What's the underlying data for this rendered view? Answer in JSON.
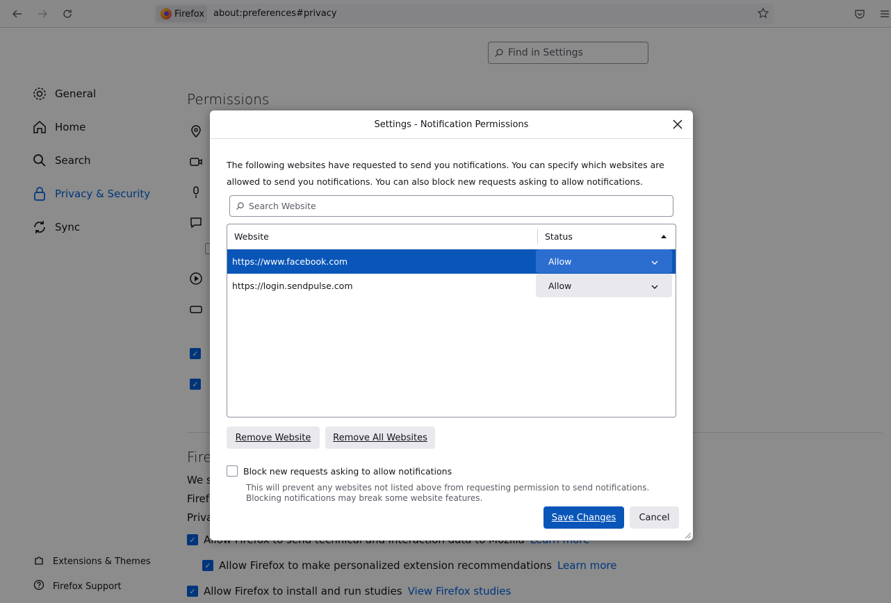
{
  "browser": {
    "identity_label": "Firefox",
    "url": "about:preferences#privacy"
  },
  "settings": {
    "find_placeholder": "Find in Settings",
    "categories": [
      {
        "label": "General"
      },
      {
        "label": "Home"
      },
      {
        "label": "Search"
      },
      {
        "label": "Privacy & Security"
      },
      {
        "label": "Sync"
      }
    ],
    "footer": {
      "extensions": "Extensions & Themes",
      "support": "Firefox Support"
    },
    "permissions_title": "Permissions",
    "collection": {
      "heading_fragment": "Fire",
      "text_fragment1": "We s",
      "text_fragment2": "Firef",
      "link_fragment": "Priva",
      "telemetry_label": "Allow Firefox to send technical and interaction data to Mozilla",
      "telemetry_link": "Learn more",
      "extension_rec_label": "Allow Firefox to make personalized extension recommendations",
      "extension_rec_link": "Learn more",
      "studies_label": "Allow Firefox to install and run studies",
      "studies_link": "View Firefox studies"
    }
  },
  "dialog": {
    "title": "Settings - Notification Permissions",
    "description": "The following websites have requested to send you notifications. You can specify which websites are allowed to send you notifications. You can also block new requests asking to allow notifications.",
    "search_placeholder": "Search Website",
    "columns": {
      "website": "Website",
      "status": "Status"
    },
    "rows": [
      {
        "website": "https://www.facebook.com",
        "status": "Allow"
      },
      {
        "website": "https://login.sendpulse.com",
        "status": "Allow"
      }
    ],
    "remove_website": "Remove Website",
    "remove_all": "Remove All Websites",
    "block_label": "Block new requests asking to allow notifications",
    "block_note": "This will prevent any websites not listed above from requesting permission to send notifications. Blocking notifications may break some website features.",
    "save": "Save Changes",
    "cancel": "Cancel"
  },
  "colors": {
    "accent": "#0061e0",
    "selected_row": "#0a56b8"
  }
}
